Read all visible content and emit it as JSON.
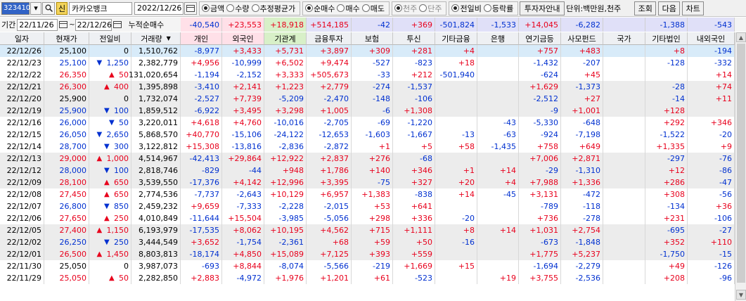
{
  "toolbar": {
    "code": "323410",
    "badge": "신",
    "name": "카카오뱅크",
    "date": "2022/12/26",
    "radio1": [
      {
        "label": "금액",
        "on": true
      },
      {
        "label": "수량",
        "on": false
      },
      {
        "label": "추정평균가",
        "on": false
      }
    ],
    "radio2": [
      {
        "label": "순매수",
        "on": true
      },
      {
        "label": "매수",
        "on": false
      },
      {
        "label": "매도",
        "on": false
      }
    ],
    "radio3": [
      {
        "label": "천주",
        "on": true
      },
      {
        "label": "단주",
        "on": false
      }
    ],
    "radio4": [
      {
        "label": "전일비",
        "on": true
      },
      {
        "label": "등락률",
        "on": false
      }
    ],
    "investor_info": "투자자안내",
    "unit": "단위:백만원,천주",
    "btn_query": "조회",
    "btn_next": "다음",
    "btn_chart": "차트"
  },
  "filter": {
    "period_label": "기간",
    "date_from": "22/11/26",
    "date_to": "22/12/26",
    "cumulative_label": "누적순매수",
    "sums": [
      "-40,540",
      "+23,553",
      "+18,918",
      "+514,185",
      "-42",
      "+369",
      "-501,824",
      "-1,533",
      "+14,045",
      "-6,282",
      "",
      "-1,388",
      "-543"
    ]
  },
  "columns": [
    "일자",
    "현재가",
    "전일비",
    "거래량",
    "개인",
    "외국인",
    "기관계",
    "금융투자",
    "보험",
    "투신",
    "기타금융",
    "은행",
    "연기금등",
    "사모펀드",
    "국가",
    "기타법인",
    "내외국인"
  ],
  "rows": [
    [
      "22/12/26",
      "25,100",
      "",
      "0",
      "1,510,762",
      "-8,977",
      "+3,433",
      "+5,731",
      "+3,897",
      "+309",
      "+281",
      "+4",
      "",
      "+757",
      "+483",
      "",
      "+8",
      "-194"
    ],
    [
      "22/12/23",
      "25,100",
      "dn",
      "1,250",
      "2,382,779",
      "+4,956",
      "-10,999",
      "+6,502",
      "+9,474",
      "-527",
      "-823",
      "+18",
      "",
      "-1,432",
      "-207",
      "",
      "-128",
      "-332"
    ],
    [
      "22/12/22",
      "26,350",
      "up",
      "50",
      "131,020,654",
      "-1,194",
      "-2,152",
      "+3,333",
      "+505,673",
      "-33",
      "+212",
      "-501,940",
      "",
      "-624",
      "+45",
      "",
      "",
      "+14"
    ],
    [
      "22/12/21",
      "26,300",
      "up",
      "400",
      "1,395,898",
      "-3,410",
      "+2,141",
      "+1,223",
      "+2,779",
      "-274",
      "-1,537",
      "",
      "",
      "+1,629",
      "-1,373",
      "",
      "-28",
      "+74"
    ],
    [
      "22/12/20",
      "25,900",
      "",
      "0",
      "1,732,074",
      "-2,527",
      "+7,739",
      "-5,209",
      "-2,470",
      "-148",
      "-106",
      "",
      "",
      "-2,512",
      "+27",
      "",
      "-14",
      "+11"
    ],
    [
      "22/12/19",
      "25,900",
      "dn",
      "100",
      "1,859,512",
      "-6,922",
      "+3,495",
      "+3,298",
      "+1,005",
      "-6",
      "+1,308",
      "",
      "",
      "-9",
      "+1,001",
      "",
      "+128",
      ""
    ],
    [
      "22/12/16",
      "26,000",
      "dn",
      "50",
      "3,220,011",
      "+4,618",
      "+4,760",
      "-10,016",
      "-2,705",
      "-69",
      "-1,220",
      "",
      "-43",
      "-5,330",
      "-648",
      "",
      "+292",
      "+346"
    ],
    [
      "22/12/15",
      "26,050",
      "dn",
      "2,650",
      "5,868,570",
      "+40,770",
      "-15,106",
      "-24,122",
      "-12,653",
      "-1,603",
      "-1,667",
      "-13",
      "-63",
      "-924",
      "-7,198",
      "",
      "-1,522",
      "-20"
    ],
    [
      "22/12/14",
      "28,700",
      "dn",
      "300",
      "3,122,812",
      "+15,308",
      "-13,816",
      "-2,836",
      "-2,872",
      "+1",
      "+5",
      "+58",
      "-1,435",
      "+758",
      "+649",
      "",
      "+1,335",
      "+9"
    ],
    [
      "22/12/13",
      "29,000",
      "up",
      "1,000",
      "4,514,967",
      "-42,413",
      "+29,864",
      "+12,922",
      "+2,837",
      "+276",
      "-68",
      "",
      "",
      "+7,006",
      "+2,871",
      "",
      "-297",
      "-76"
    ],
    [
      "22/12/12",
      "28,000",
      "dn",
      "100",
      "2,818,746",
      "-829",
      "-44",
      "+948",
      "+1,786",
      "+140",
      "+346",
      "+1",
      "+14",
      "-29",
      "-1,310",
      "",
      "+12",
      "-86"
    ],
    [
      "22/12/09",
      "28,100",
      "up",
      "650",
      "3,539,550",
      "-17,376",
      "+4,142",
      "+12,996",
      "+3,395",
      "-75",
      "+327",
      "+20",
      "+4",
      "+7,988",
      "+1,336",
      "",
      "+286",
      "-47"
    ],
    [
      "22/12/08",
      "27,450",
      "up",
      "650",
      "2,774,536",
      "-7,737",
      "-2,643",
      "+10,129",
      "+6,957",
      "+1,383",
      "-838",
      "+14",
      "-45",
      "+3,131",
      "-472",
      "",
      "+308",
      "-56"
    ],
    [
      "22/12/07",
      "26,800",
      "dn",
      "850",
      "2,459,232",
      "+9,659",
      "-7,333",
      "-2,228",
      "-2,015",
      "+53",
      "+641",
      "",
      "",
      "-789",
      "-118",
      "",
      "-134",
      "+36"
    ],
    [
      "22/12/06",
      "27,650",
      "up",
      "250",
      "4,010,849",
      "-11,644",
      "+15,504",
      "-3,985",
      "-5,056",
      "+298",
      "+336",
      "-20",
      "",
      "+736",
      "-278",
      "",
      "+231",
      "-106"
    ],
    [
      "22/12/05",
      "27,400",
      "up",
      "1,150",
      "6,193,979",
      "-17,535",
      "+8,062",
      "+10,195",
      "+4,562",
      "+715",
      "+1,111",
      "+8",
      "+14",
      "+1,031",
      "+2,754",
      "",
      "-695",
      "-27"
    ],
    [
      "22/12/02",
      "26,250",
      "dn",
      "250",
      "3,444,549",
      "+3,652",
      "-1,754",
      "-2,361",
      "+68",
      "+59",
      "+50",
      "-16",
      "",
      "-673",
      "-1,848",
      "",
      "+352",
      "+110"
    ],
    [
      "22/12/01",
      "26,500",
      "up",
      "1,450",
      "8,803,813",
      "-18,174",
      "+4,850",
      "+15,089",
      "+7,125",
      "+393",
      "+559",
      "",
      "",
      "+1,775",
      "+5,237",
      "",
      "-1,750",
      "-15"
    ],
    [
      "22/11/30",
      "25,050",
      "",
      "0",
      "3,987,073",
      "-693",
      "+8,844",
      "-8,074",
      "-5,566",
      "-219",
      "+1,669",
      "+15",
      "",
      "-1,694",
      "-2,279",
      "",
      "+49",
      "-126"
    ],
    [
      "22/11/29",
      "25,050",
      "up",
      "50",
      "2,282,850",
      "+2,883",
      "-4,972",
      "+1,976",
      "+1,201",
      "+61",
      "-523",
      "",
      "+19",
      "+3,755",
      "-2,536",
      "",
      "+208",
      "-96"
    ]
  ],
  "colors": {
    "up": "#e8001c",
    "down": "#0030d0",
    "selected_row": "#d8ebf9",
    "alt_row": "#ececec",
    "code_bg": "#3163c6",
    "header_pink": "#ffe0e8",
    "header_green": "#d8f0c8",
    "header_lavender": "#e0e0f8"
  },
  "icons": [
    "search-icon",
    "calendar-icon",
    "sort-down-icon",
    "triangle-up-icon",
    "triangle-down-icon"
  ]
}
